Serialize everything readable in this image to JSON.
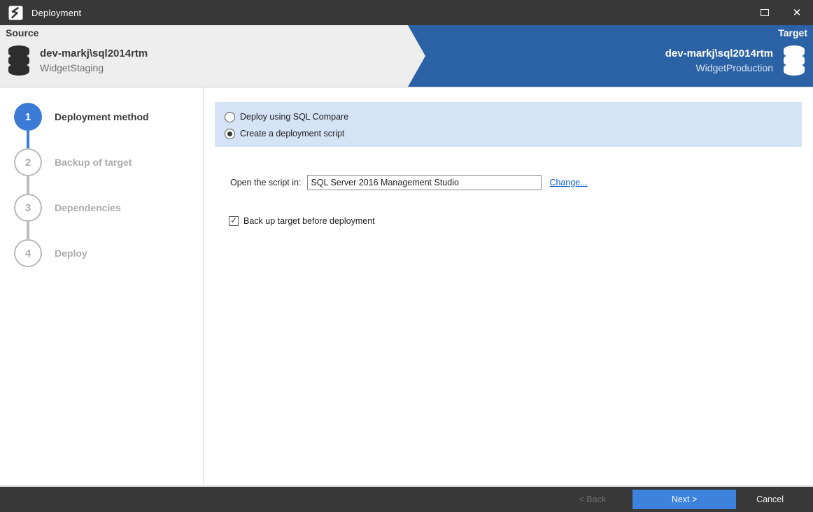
{
  "window": {
    "title": "Deployment"
  },
  "header": {
    "source": {
      "label": "Source",
      "server": "dev-markj\\sql2014rtm",
      "database": "WidgetStaging"
    },
    "target": {
      "label": "Target",
      "server": "dev-markj\\sql2014rtm",
      "database": "WidgetProduction"
    }
  },
  "steps": [
    {
      "number": "1",
      "label": "Deployment method",
      "state": "active"
    },
    {
      "number": "2",
      "label": "Backup of target",
      "state": "pending"
    },
    {
      "number": "3",
      "label": "Dependencies",
      "state": "pending"
    },
    {
      "number": "4",
      "label": "Deploy",
      "state": "pending"
    }
  ],
  "main": {
    "options": [
      {
        "label": "Deploy using SQL Compare",
        "selected": false
      },
      {
        "label": "Create a deployment script",
        "selected": true
      }
    ],
    "open_script": {
      "label": "Open the script in:",
      "value": "SQL Server 2016 Management Studio",
      "change_link": "Change..."
    },
    "backup_checkbox": {
      "label": "Back up target before deployment",
      "checked": true,
      "check_glyph": "✓"
    }
  },
  "footer": {
    "back_label": "< Back",
    "next_label": "Next >",
    "cancel_label": "Cancel"
  },
  "colors": {
    "titlebar_bg": "#383838",
    "header_blue": "#2b62a5",
    "header_gray": "#eeeeee",
    "accent_blue": "#3a7bd7",
    "panel_blue": "#d5e3f7",
    "link_blue": "#0a5bc4",
    "next_button_blue": "#3d82dc"
  }
}
